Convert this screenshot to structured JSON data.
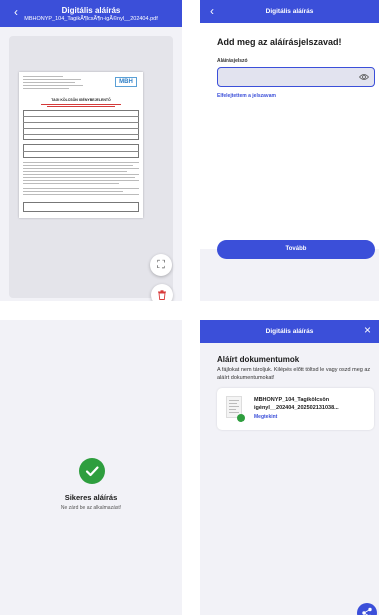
{
  "screen1": {
    "title": "Digitális aláírás",
    "filename": "MBHONYP_104_TagikÃ¶lcsÃ¶n-igÃ©nyl__202404.pdf",
    "document_title": "TAGI KÖLCSÖN IGÉNYBEJELENTŐ",
    "logo_text": "MBH"
  },
  "screen2": {
    "title": "Digitális aláírás",
    "heading": "Add meg az aláírásjelszavad!",
    "field_label": "Aláírásjelszó",
    "field_value": "",
    "forgot_link": "Elfelejtettem a jelszavam",
    "next_button": "Tovább"
  },
  "screen3": {
    "title": "Sikeres aláírás",
    "subtitle": "Ne zárd be az alkalmazást!"
  },
  "screen4": {
    "title": "Digitális aláírás",
    "heading": "Aláírt dokumentumok",
    "description": "A fájlokat nem tároljuk. Kilépés előtt töltsd le vagy oszd meg az aláírt dokumentumokat!",
    "document_name": "MBHONYP_104_Tagikölcsön igényl__202404_202502131038...",
    "open_link": "Megtekint"
  },
  "colors": {
    "primary": "#3b4fd9",
    "success": "#2e9e3e",
    "danger": "#d83a3a"
  },
  "icons": [
    "back-arrow-icon",
    "close-icon",
    "eye-icon",
    "fullscreen-icon",
    "trash-icon",
    "check-icon",
    "document-icon",
    "share-icon"
  ]
}
